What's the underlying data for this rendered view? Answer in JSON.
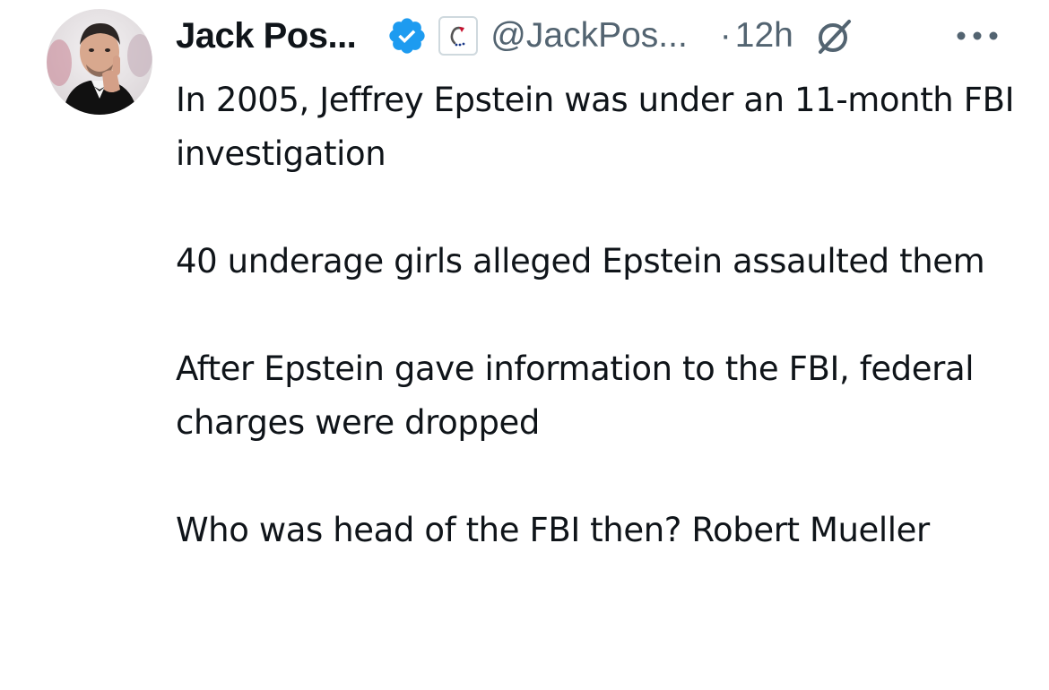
{
  "author": {
    "display_name": "Jack Pos...",
    "handle": "@JackPos...",
    "separator": "·",
    "time": "12h",
    "avatar": "avatar-photo",
    "verified_color": "#1d9bf0"
  },
  "icons": {
    "verified": "verified-badge-icon",
    "affiliate": "affiliate-badge-icon",
    "grok": "grok-icon",
    "more": "more-options-icon"
  },
  "tweet": {
    "paragraphs": [
      "In 2005, Jeffrey Epstein was under an 11-month FBI investigation",
      "40 underage girls alleged Epstein assaulted them",
      "After Epstein gave information to the FBI, federal charges were dropped",
      "Who was head of the FBI then?  Robert Mueller"
    ]
  },
  "colors": {
    "text": "#0f1419",
    "secondary": "#536471",
    "accent": "#1d9bf0"
  }
}
